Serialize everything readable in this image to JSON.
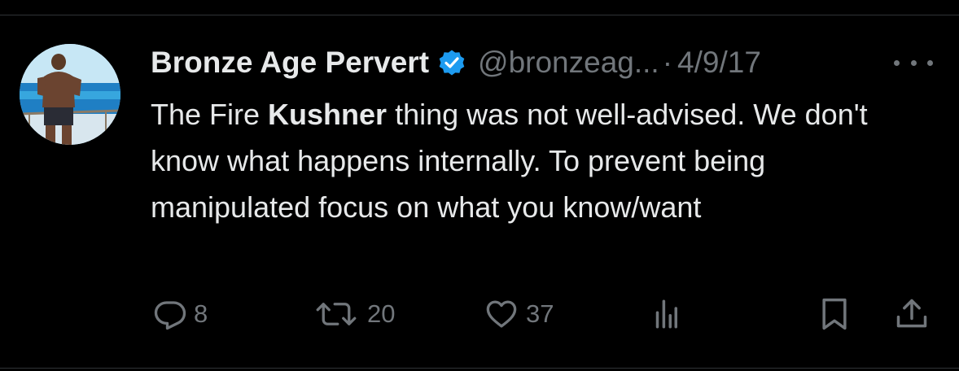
{
  "tweet": {
    "author": {
      "display_name": "Bronze Age Pervert",
      "handle": "@bronzeag...",
      "verified": true
    },
    "separator": "·",
    "date": "4/9/17",
    "text": {
      "part1": "The Fire ",
      "bold": "Kushner",
      "part2": " thing was not well-advised. We don't know what happens internally. To prevent being manipulated focus on what you know/want"
    },
    "actions": {
      "replies": "8",
      "reposts": "20",
      "likes": "37"
    }
  },
  "icons": {
    "avatar": "avatar-beach-photo",
    "verified": "verified-badge-icon",
    "more": "more-options-icon",
    "reply": "reply-icon",
    "repost": "repost-icon",
    "like": "heart-icon",
    "views": "views-bar-chart-icon",
    "bookmark": "bookmark-icon",
    "share": "share-icon"
  },
  "colors": {
    "background": "#000000",
    "text": "#e7e9ea",
    "secondary": "#71767b",
    "verified": "#1d9bf0",
    "divider": "#2f3336"
  }
}
